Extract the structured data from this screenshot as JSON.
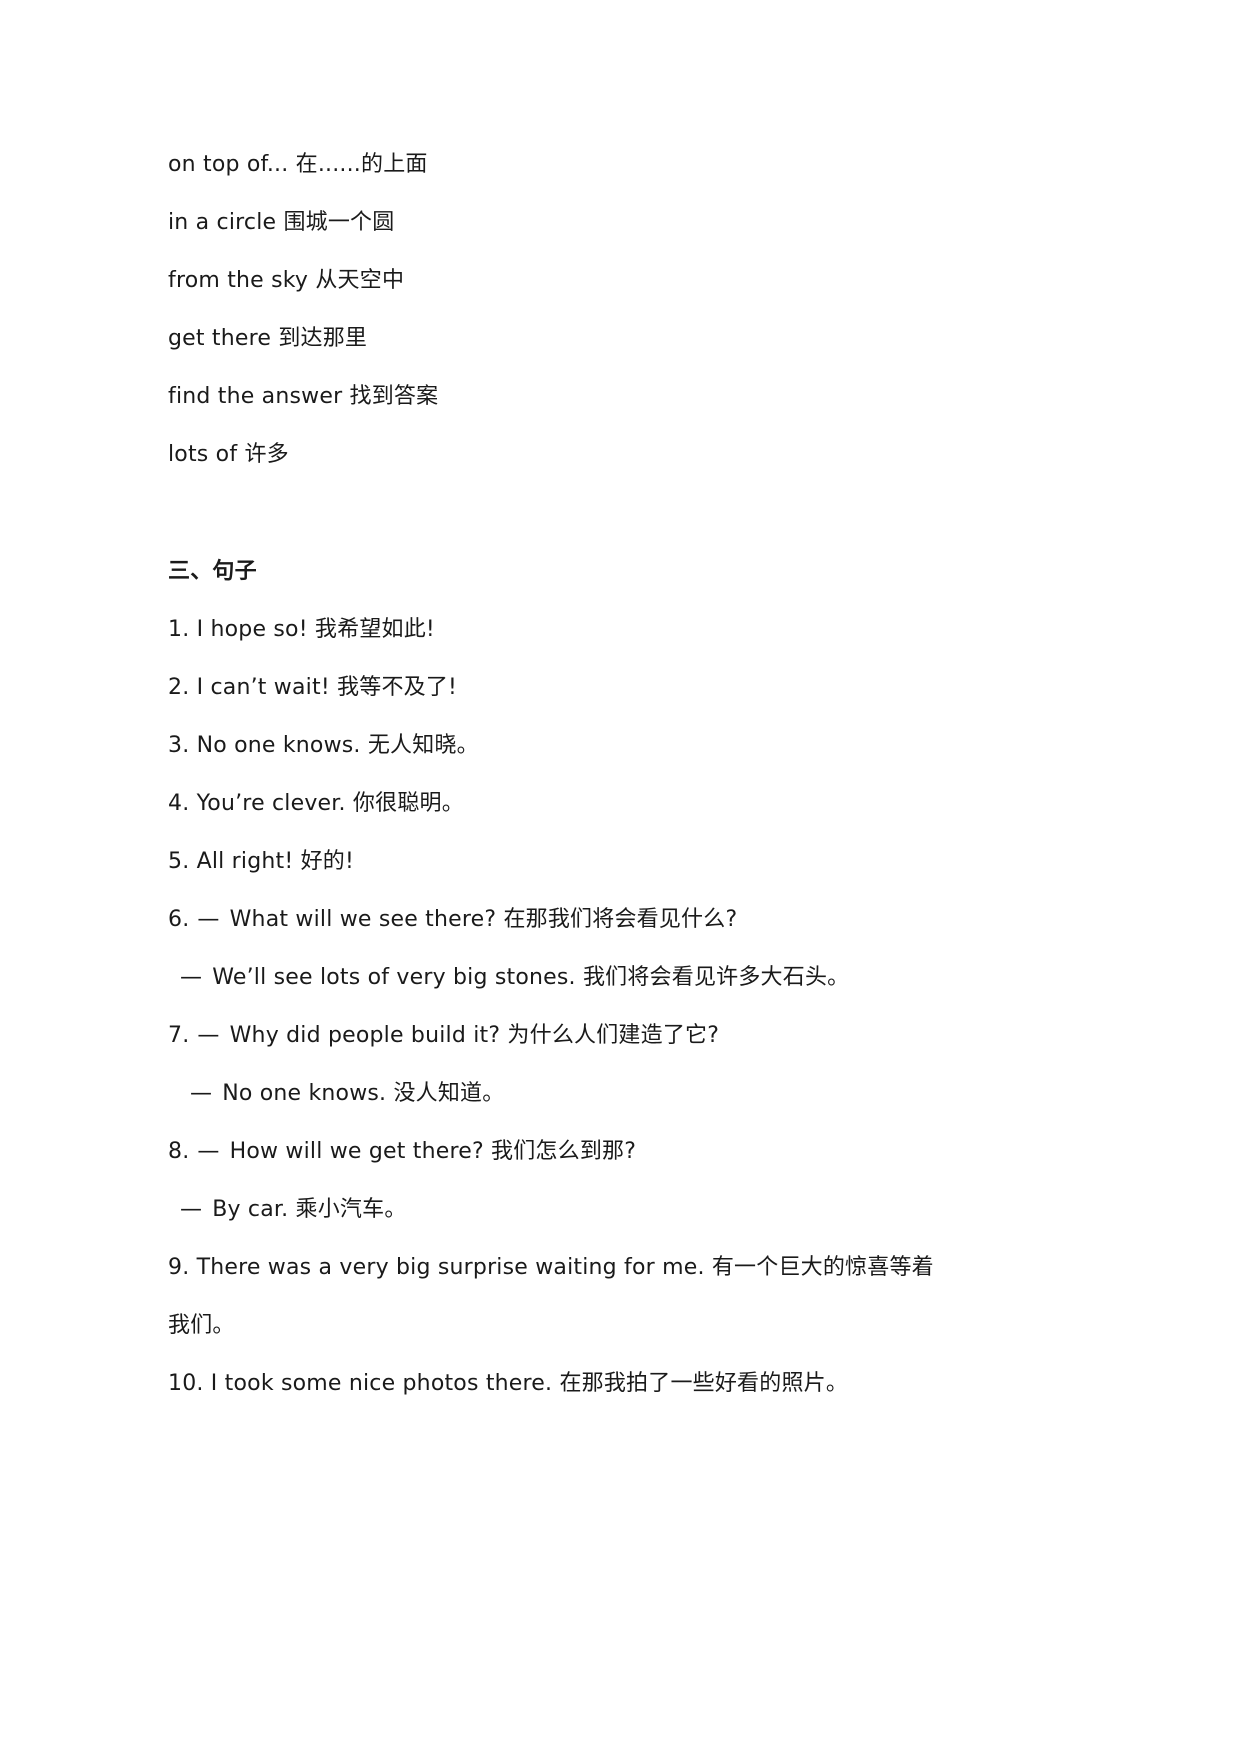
{
  "phrases": [
    {
      "en": "on top of...",
      "zh": "在......的上面"
    },
    {
      "en": "in a circle",
      "zh": "围城一个圆"
    },
    {
      "en": "from the sky",
      "zh": "从天空中"
    },
    {
      "en": "get there",
      "zh": "到达那里"
    },
    {
      "en": "find the answer",
      "zh": "找到答案"
    },
    {
      "en": "lots of",
      "zh": "许多"
    }
  ],
  "sentences_section": {
    "heading": "三、句子",
    "items": [
      {
        "num": "1.",
        "en": "I hope so!",
        "zh": "我希望如此!"
      },
      {
        "num": "2.",
        "en": "I can’t wait!",
        "zh": "我等不及了!"
      },
      {
        "num": "3.",
        "en": "No one knows.",
        "zh": "无人知晓。"
      },
      {
        "num": "4.",
        "en": "You’re clever.",
        "zh": "你很聪明。"
      },
      {
        "num": "5.",
        "en": "All right!",
        "zh": "好的!"
      },
      {
        "num": "6.",
        "dash": "—",
        "en": "What will we see there?",
        "zh": "在那我们将会看见什么?",
        "reply": {
          "dash": "—",
          "en": "We’ll see lots of very big stones.",
          "zh": "我们将会看见许多大石头。"
        }
      },
      {
        "num": "7.",
        "dash": "—",
        "en": "Why did people build it?",
        "zh": "为什么人们建造了它?",
        "reply": {
          "dash": "—",
          "en": "No one knows.",
          "zh": "没人知道。"
        }
      },
      {
        "num": "8.",
        "dash": "—",
        "en": "How will we get there?",
        "zh": "我们怎么到那?",
        "reply": {
          "dash": "—",
          "en": "By car.",
          "zh": "乘小汽车。"
        }
      },
      {
        "num": "9.",
        "en": "There was a very big surprise waiting for me.",
        "zh": "有一个巨大的惊喜等着",
        "zh_cont": "我们。"
      },
      {
        "num": "10.",
        "en": "I took some nice photos there.",
        "zh": "在那我拍了一些好看的照片。"
      }
    ]
  }
}
